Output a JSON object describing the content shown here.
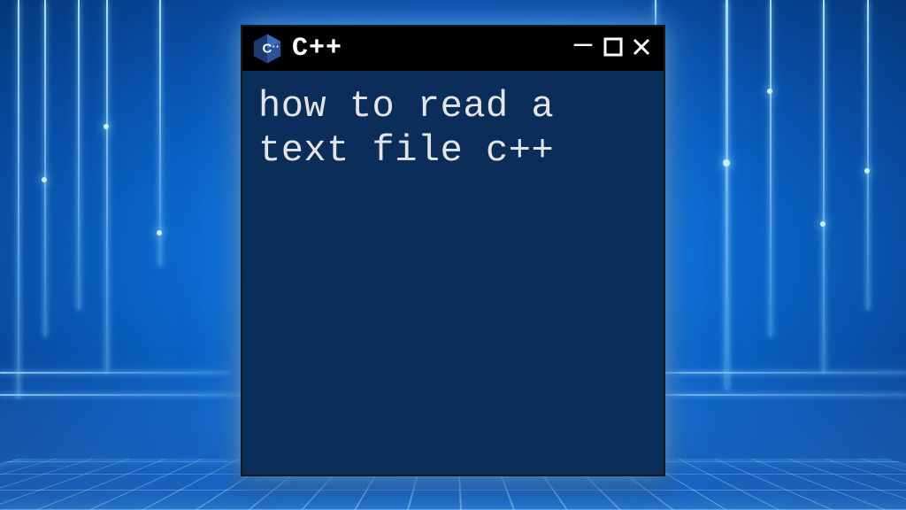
{
  "window": {
    "title": "C++",
    "icon_name": "cpp-icon"
  },
  "content": {
    "text": "how to read a text file c++"
  },
  "controls": {
    "minimize": "—",
    "maximize": "☐",
    "close": "✕"
  }
}
